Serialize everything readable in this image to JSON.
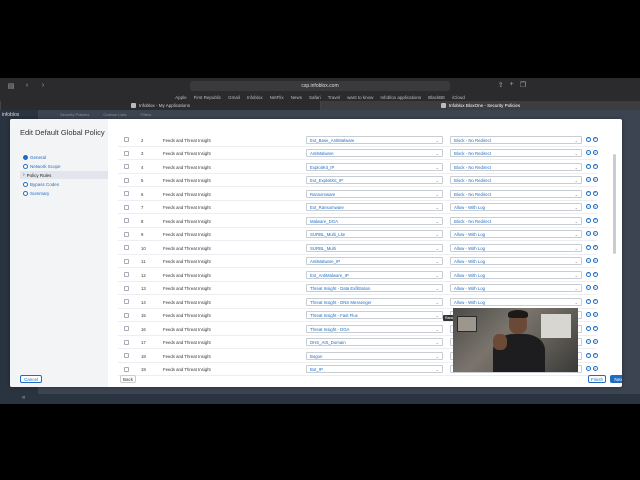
{
  "browser": {
    "url": "csp.infoblox.com",
    "bookmarks": [
      "Apple",
      "First Republic",
      "Gmail",
      "Infoblox",
      "NetFlix",
      "News",
      "Safari",
      "Travel",
      "want to know",
      "Infoblox applications",
      "BlackBE",
      "iCloud"
    ],
    "tabs": [
      {
        "label": "Infoblox - My Applications",
        "active": false
      },
      {
        "label": "Infoblox BloxOne - Security Policies",
        "active": true
      }
    ]
  },
  "app": {
    "logo": "infoblox",
    "bg_tabs": [
      "Security Policies",
      "Custom Lists",
      "Filters"
    ]
  },
  "wizard": {
    "title": "Edit Default Global Policy",
    "steps": [
      {
        "label": "General",
        "state": "done"
      },
      {
        "label": "Network Scope",
        "state": "todo"
      },
      {
        "label": "Policy Rules",
        "state": "active"
      },
      {
        "label": "Bypass Codes",
        "state": "todo"
      },
      {
        "label": "Summary",
        "state": "todo"
      }
    ],
    "cancel_label": "Cancel",
    "back_label": "Back",
    "finish_label": "Finish",
    "next_label": "Next",
    "tooltip": "Ransomware"
  },
  "rules": [
    {
      "num": "2",
      "feed": "Feeds and Threat Insight",
      "policy": "Ext_Base_AntiMalware",
      "action": "Block - No Redirect"
    },
    {
      "num": "3",
      "feed": "Feeds and Threat Insight",
      "policy": "AntiMalware",
      "action": "Block - No Redirect"
    },
    {
      "num": "4",
      "feed": "Feeds and Threat Insight",
      "policy": "ExploitKit_IP",
      "action": "Block - No Redirect"
    },
    {
      "num": "5",
      "feed": "Feeds and Threat Insight",
      "policy": "Ext_ExploitKit_IP",
      "action": "Block - No Redirect"
    },
    {
      "num": "6",
      "feed": "Feeds and Threat Insight",
      "policy": "Ransomware",
      "action": "Block - No Redirect"
    },
    {
      "num": "7",
      "feed": "Feeds and Threat Insight",
      "policy": "Ext_Ransomware",
      "action": "Allow - With Log"
    },
    {
      "num": "8",
      "feed": "Feeds and Threat Insight",
      "policy": "Malware_DGA",
      "action": "Block - No Redirect"
    },
    {
      "num": "9",
      "feed": "Feeds and Threat Insight",
      "policy": "SURBL_Multi_Lite",
      "action": "Allow - With Log"
    },
    {
      "num": "10",
      "feed": "Feeds and Threat Insight",
      "policy": "SURBL_Multi",
      "action": "Allow - With Log"
    },
    {
      "num": "11",
      "feed": "Feeds and Threat Insight",
      "policy": "AntiMalware_IP",
      "action": "Allow - With Log"
    },
    {
      "num": "12",
      "feed": "Feeds and Threat Insight",
      "policy": "Ext_AntiMalware_IP",
      "action": "Allow - With Log"
    },
    {
      "num": "13",
      "feed": "Feeds and Threat Insight",
      "policy": "Threat Insight - Data Exfiltration",
      "action": "Allow - With Log"
    },
    {
      "num": "14",
      "feed": "Feeds and Threat Insight",
      "policy": "Threat Insight - DNS Messenger",
      "action": "Allow - With Log"
    },
    {
      "num": "15",
      "feed": "Feeds and Threat Insight",
      "policy": "Threat Insight - Fast Flux",
      "action": "A"
    },
    {
      "num": "16",
      "feed": "Feeds and Threat Insight",
      "policy": "Threat Insight - DGA",
      "action": "A"
    },
    {
      "num": "17",
      "feed": "Feeds and Threat Insight",
      "policy": "DHS_AIS_Domain",
      "action": "A"
    },
    {
      "num": "18",
      "feed": "Feeds and Threat Insight",
      "policy": "Bogon",
      "action": "A"
    },
    {
      "num": "19",
      "feed": "Feeds and Threat Insight",
      "policy": "Bot_IP",
      "action": "A"
    }
  ]
}
